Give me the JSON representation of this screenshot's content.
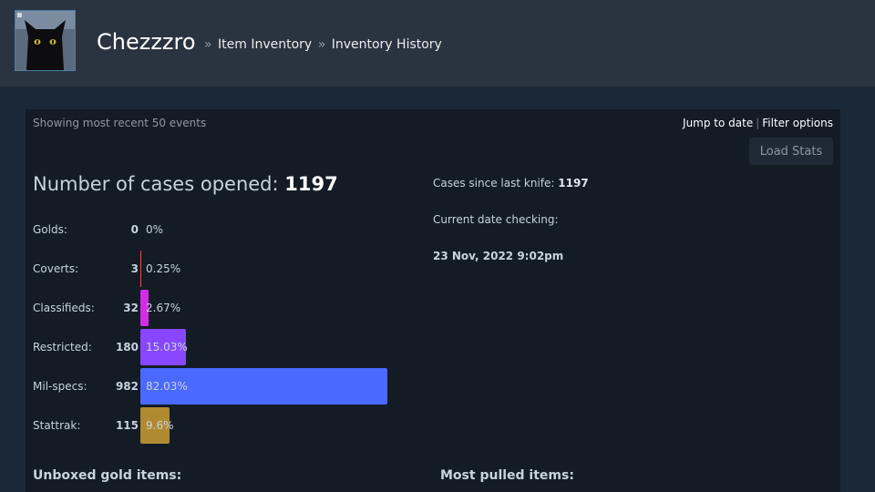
{
  "profile": {
    "name": "Chezzzro",
    "crumbs": [
      "Item Inventory",
      "Inventory History"
    ],
    "sep": "»"
  },
  "inventory": {
    "showing": "Showing most recent 50 events",
    "jump_label": "Jump to date",
    "filter_label": "Filter options",
    "load_stats": "Load Stats",
    "cases_label": "Number of cases opened:",
    "cases_value": "1197",
    "stats": [
      {
        "label": "Golds:",
        "count": "0",
        "pct": "0%",
        "fraction": 0.0,
        "color": "#e4ae39"
      },
      {
        "label": "Coverts:",
        "count": "3",
        "pct": "0.25%",
        "fraction": 0.0025,
        "color": "#eb4b4b"
      },
      {
        "label": "Classifieds:",
        "count": "32",
        "pct": "2.67%",
        "fraction": 0.0267,
        "color": "#d32ce6"
      },
      {
        "label": "Restricted:",
        "count": "180",
        "pct": "15.03%",
        "fraction": 0.1503,
        "color": "#8847ff"
      },
      {
        "label": "Mil-specs:",
        "count": "982",
        "pct": "82.03%",
        "fraction": 0.8203,
        "color": "#4b69ff"
      },
      {
        "label": "Stattrak:",
        "count": "115",
        "pct": "9.6%",
        "fraction": 0.096,
        "color": "#b08a30"
      }
    ],
    "since_knife_label": "Cases since last knife:",
    "since_knife_value": "1197",
    "date_check_label": "Current date checking:",
    "date_check_value": "23 Nov, 2022 9:02pm",
    "gold_items_heading": "Unboxed gold items:",
    "most_pulled_heading": "Most pulled items:"
  }
}
